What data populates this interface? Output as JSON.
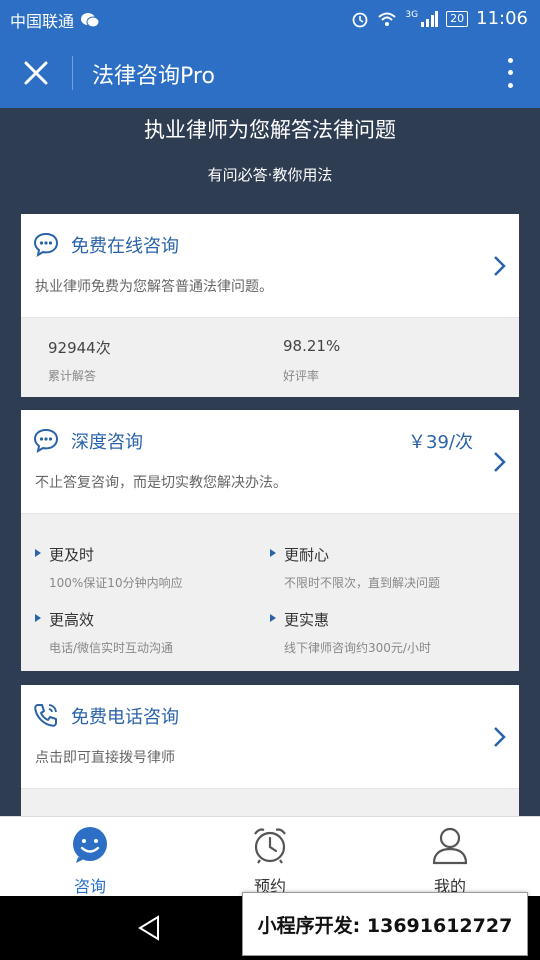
{
  "status_bar": {
    "carrier": "中国联通",
    "network": "3G",
    "battery": "20",
    "time": "11:06"
  },
  "title_bar": {
    "title": "法律咨询Pro"
  },
  "hero": {
    "title": "执业律师为您解答法律问题",
    "subtitle": "有问必答·教你用法"
  },
  "cards": {
    "free_online": {
      "title": "免费在线咨询",
      "desc": "执业律师免费为您解答普通法律问题。",
      "stats": [
        {
          "value": "92944次",
          "label": "累计解答"
        },
        {
          "value": "98.21%",
          "label": "好评率"
        }
      ]
    },
    "deep": {
      "title": "深度咨询",
      "price": "￥39/次",
      "desc": "不止答复咨询，而是切实教您解决办法。",
      "features": [
        {
          "title": "更及时",
          "desc": "100%保证10分钟内响应"
        },
        {
          "title": "更耐心",
          "desc": "不限时不限次，直到解决问题"
        },
        {
          "title": "更高效",
          "desc": "电话/微信实时互动沟通"
        },
        {
          "title": "更实惠",
          "desc": "线下律师咨询约300元/小时"
        }
      ]
    },
    "phone": {
      "title": "免费电话咨询",
      "desc": "点击即可直接拨号律师"
    }
  },
  "tabs": [
    {
      "label": "咨询",
      "icon": "smile-chat-icon",
      "active": true
    },
    {
      "label": "预约",
      "icon": "alarm-clock-icon",
      "active": false
    },
    {
      "label": "我的",
      "icon": "user-icon",
      "active": false
    }
  ],
  "promo": {
    "text": "小程序开发: 13691612727"
  },
  "colors": {
    "brand_blue": "#2c6fc4",
    "background": "#2f3d52",
    "title_blue": "#2b63a9"
  }
}
